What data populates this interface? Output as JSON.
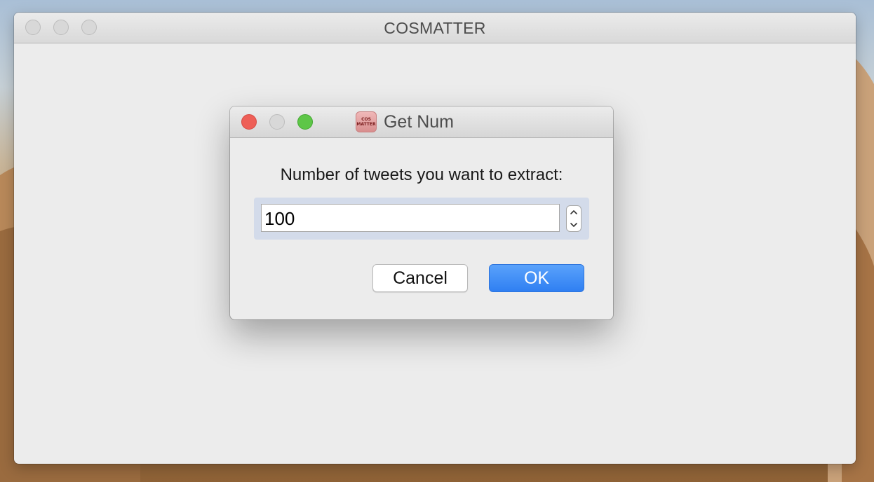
{
  "main_window": {
    "title": "COSMATTER"
  },
  "dialog": {
    "title": "Get Num",
    "app_icon": {
      "name": "cosmatter-app-icon",
      "line1": "COS",
      "line2": "MATTER"
    },
    "prompt": "Number of tweets you want to extract:",
    "spinbox": {
      "value": "100"
    },
    "buttons": {
      "cancel": "Cancel",
      "ok": "OK"
    }
  },
  "colors": {
    "accent": "#3a86f5",
    "close": "#ee5f57",
    "zoom": "#5ec648",
    "window_bg": "#ececec"
  }
}
